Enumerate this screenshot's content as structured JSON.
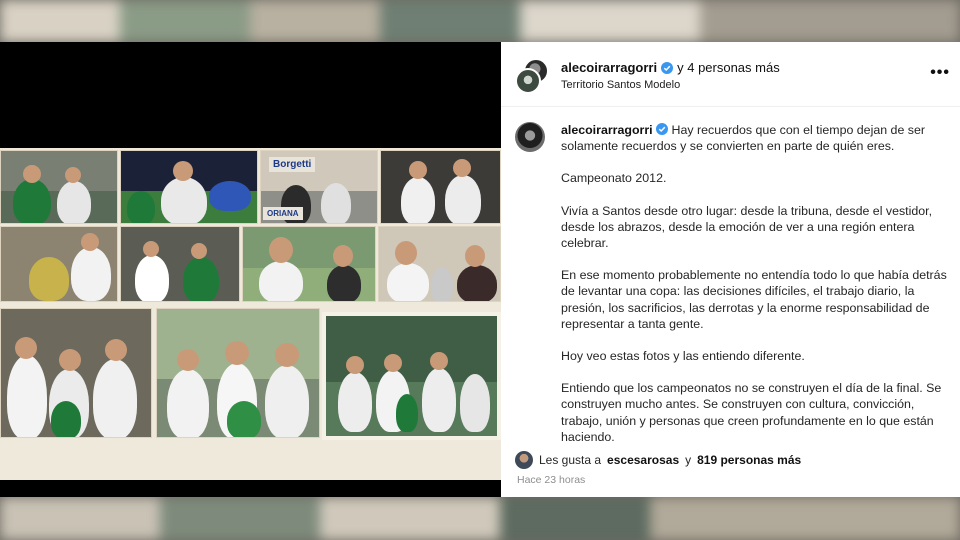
{
  "header": {
    "username": "alecoirarragorri",
    "coauthors": "y 4 personas más",
    "location": "Territorio Santos Modelo",
    "more_icon": "more-horizontal-icon"
  },
  "caption": {
    "username": "alecoirarragorri",
    "paragraphs": [
      "Hay recuerdos que con el tiempo dejan de ser solamente recuerdos y se convierten en parte de quién eres.",
      "Campeonato 2012.",
      "Vivía a Santos desde otro lugar: desde la tribuna, desde el vestidor, desde los abrazos, desde la emoción de ver a una región entera celebrar.",
      "En ese momento probablemente no entendía todo lo que había detrás de levantar una copa: las decisiones difíciles, el trabajo diario, la presión, los sacrificios, las derrotas y la enorme responsabilidad de representar a tanta gente.",
      "Hoy veo estas fotos y las entiendo diferente.",
      "Entiendo que los campeonatos no se construyen el día de la final. Se construyen mucho antes. Se construyen con cultura, convicción, trabajo, unión y personas que creen profundamente en lo que están haciendo."
    ]
  },
  "likes": {
    "prefix": "Les gusta a",
    "user": "escesarosas",
    "connector": "y",
    "others": "819 personas más"
  },
  "timestamp": "Hace 23 horas",
  "photo": {
    "banner_1": "Borgetti",
    "banner_2": "ORIANA"
  },
  "colors": {
    "verified": "#3897f0",
    "santos_green": "#1f7a3a",
    "panel_bg": "#ffffff",
    "media_bg": "#000000"
  }
}
